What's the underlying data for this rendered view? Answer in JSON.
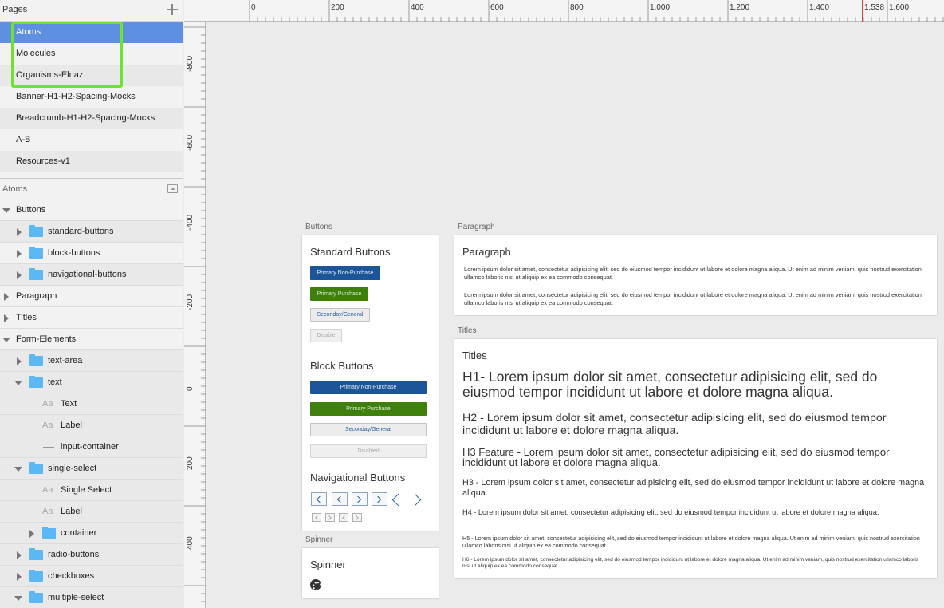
{
  "sidebar": {
    "pages_title": "Pages",
    "pages": [
      {
        "label": "Atoms"
      },
      {
        "label": "Molecules"
      },
      {
        "label": "Organisms-Elnaz"
      },
      {
        "label": "Banner-H1-H2-Spacing-Mocks"
      },
      {
        "label": "Breadcrumb-H1-H2-Spacing-Mocks"
      },
      {
        "label": "A-B"
      },
      {
        "label": "Resources-v1"
      }
    ],
    "layers_title": "Atoms",
    "layers": [
      {
        "label": "Buttons"
      },
      {
        "label": "standard-buttons"
      },
      {
        "label": "block-buttons"
      },
      {
        "label": "navigational-buttons"
      },
      {
        "label": "Paragraph"
      },
      {
        "label": "Titles"
      },
      {
        "label": "Form-Elements"
      },
      {
        "label": "text-area"
      },
      {
        "label": "text"
      },
      {
        "label": "Text"
      },
      {
        "label": "Label"
      },
      {
        "label": "input-container"
      },
      {
        "label": "single-select"
      },
      {
        "label": "Single Select"
      },
      {
        "label": "Label"
      },
      {
        "label": "container"
      },
      {
        "label": "radio-buttons"
      },
      {
        "label": "checkboxes"
      },
      {
        "label": "multiple-select"
      }
    ],
    "text_layer_glyph": "Aa"
  },
  "ruler": {
    "top": [
      "0",
      "200",
      "400",
      "600",
      "800",
      "1,000",
      "1,200",
      "1,400",
      "1,538",
      "1,600"
    ],
    "left": [
      "-800",
      "-600",
      "-400",
      "-200",
      "0",
      "200",
      "400"
    ]
  },
  "canvas": {
    "buttons_artboard": {
      "title": "Buttons",
      "standard_heading": "Standard Buttons",
      "std_primary": "Primary Non-Purchase",
      "std_purchase": "Primary Purchase",
      "std_general": "Seconday/General",
      "std_disable": "Disable",
      "block_heading": "Block Buttons",
      "blk_primary": "Primary Non-Purchase",
      "blk_purchase": "Primary Purchase",
      "blk_general": "Seconday/General",
      "blk_disabled": "Disabled",
      "nav_heading": "Navigational Buttons"
    },
    "spinner_artboard": {
      "title": "Spinner",
      "heading": "Spinner"
    },
    "paragraph_artboard": {
      "title": "Paragraph",
      "heading": "Paragraph",
      "p1": "Lorem ipsum dolor sit amet, consectetur adipisicing elit, sed do eiusmod tempor incididunt ut labore et dolore magna aliqua. Ut enim ad minim veniam, quis nostrud exercitation ullamco laboris nisi ut aliquip ex ea commodo consequat.",
      "p2": "Lorem ipsum dolor sit amet, consectetur adipisicing elit, sed do eiusmod tempor incididunt ut labore et dolore magna aliqua. Ut enim ad minim veniam, quis nostrud exercitation ullamco laboris nisi ut aliquip ex ea commodo consequat."
    },
    "titles_artboard": {
      "title": "Titles",
      "heading": "Titles",
      "h1": "H1- Lorem ipsum dolor sit amet, consectetur adipisicing elit, sed do eiusmod tempor incididunt ut labore et dolore magna aliqua.",
      "h2": "H2 - Lorem ipsum dolor sit amet, consectetur adipisicing elit, sed do eiusmod tempor incididunt ut labore et dolore magna aliqua.",
      "h3f": "H3 Feature - Lorem ipsum dolor sit amet, consectetur adipisicing elit, sed do eiusmod tempor incididunt ut labore et dolore magna aliqua.",
      "h3": "H3 - Lorem ipsum dolor sit amet, consectetur adipisicing elit, sed do eiusmod tempor incididunt ut labore et dolore magna aliqua.",
      "h4": "H4 - Lorem ipsum dolor sit amet, consectetur adipisicing elit, sed do eiusmod tempor incididunt ut labore et dolore magna aliqua.",
      "h5": "H5 - Lorem ipsum dolor sit amet, consectetur adipisicing elit, sed do eiusmod tempor incididunt ut labore et dolore magna aliqua. Ut enim ad minim veniam, quis nostrud exercitation ullamco laboris nisi ut aliquip ex ea commodo consequat.",
      "h6": "H6 - Lorem ipsum dolor sit amet, consectetur adipisicing elit, sed do eiusmod tempor incididunt ut labore et dolore magna aliqua. Ut enim ad minim veniam, quis nostrud exercitation ullamco laboris nisi ut aliquip ex ea commodo consequat."
    }
  },
  "colors": {
    "selected_page": "#5f8fe0",
    "highlight": "#6ce32c",
    "folder": "#5bb8f5",
    "primary_button": "#1d5599",
    "purchase_button": "#3f7f0b",
    "ruler_marker": "#e53b3b"
  }
}
